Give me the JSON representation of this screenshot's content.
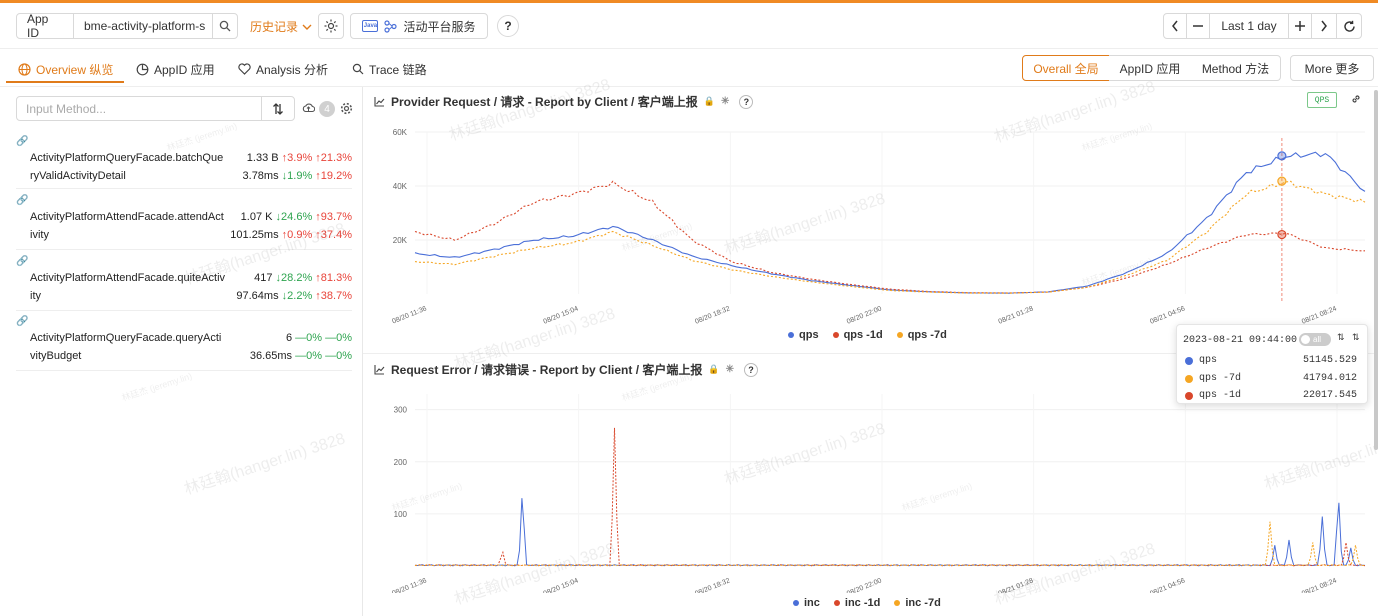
{
  "header": {
    "app_id_label": "App ID",
    "app_id_value": "bme-activity-platform-s",
    "history_label": "历史记录",
    "service_label": "活动平台服务",
    "time_range": "Last 1 day"
  },
  "tabs": [
    {
      "label": "Overview 纵览",
      "active": true
    },
    {
      "label": "AppID 应用",
      "active": false
    },
    {
      "label": "Analysis 分析",
      "active": false
    },
    {
      "label": "Trace 链路",
      "active": false
    }
  ],
  "scope": [
    "Overall 全局",
    "AppID 应用",
    "Method 方法",
    "More 更多"
  ],
  "sidebar": {
    "search_placeholder": "Input Method...",
    "badge": "4",
    "methods": [
      {
        "name": "ActivityPlatformQueryFacade.batchQueryValidActivityDetail",
        "count": "1.33 B",
        "c1": "↑3.9%",
        "c7": "↑21.3%",
        "latency": "3.78ms",
        "l1": "↓1.9%",
        "l7": "↑19.2%"
      },
      {
        "name": "ActivityPlatformAttendFacade.attendActivity",
        "count": "1.07 K",
        "c1": "↓24.6%",
        "c7": "↑93.7%",
        "latency": "101.25ms",
        "l1": "↑0.9%",
        "l7": "↑37.4%"
      },
      {
        "name": "ActivityPlatformAttendFacade.quiteActivity",
        "count": "417",
        "c1": "↓28.2%",
        "c7": "↑81.3%",
        "latency": "97.64ms",
        "l1": "↓2.2%",
        "l7": "↑38.7%"
      },
      {
        "name": "ActivityPlatformQueryFacade.queryActivityBudget",
        "count": "6",
        "c1": "—0%",
        "c7": "—0%",
        "latency": "36.65ms",
        "l1": "—0%",
        "l7": "—0%"
      }
    ]
  },
  "panels": {
    "top": {
      "title": "Provider Request / 请求 - Report by Client / 客户端上报",
      "badge": "QPS"
    },
    "bottom": {
      "title": "Request Error / 请求错误 - Report by Client / 客户端上报"
    }
  },
  "tooltip": {
    "time": "2023-08-21 09:44:00",
    "toggle": "all",
    "rows": [
      {
        "name": "qps",
        "value": "51145.529",
        "color": "#4a6fd8"
      },
      {
        "name": "qps -7d",
        "value": "41794.012",
        "color": "#f5a623"
      },
      {
        "name": "qps -1d",
        "value": "22017.545",
        "color": "#d9472b"
      }
    ]
  },
  "watermark": {
    "text": "林廷翰(hanger.lin) 3828",
    "small": "林廷杰 (jeremy.lin)"
  },
  "chart_data": [
    {
      "type": "line",
      "title": "Provider Request / 请求 - Report by Client / 客户端上报",
      "x_ticks": [
        "08/20 11:36",
        "08/20 15:04",
        "08/20 18:32",
        "08/20 22:00",
        "08/21 01:28",
        "08/21 04:56",
        "08/21 08:24"
      ],
      "y_ticks": [
        "60K",
        "40K",
        "20K"
      ],
      "ylim": [
        0,
        60000
      ],
      "x": [
        0,
        1,
        2,
        3,
        4,
        5,
        6,
        7,
        8,
        9,
        10,
        11,
        12,
        13,
        14,
        15,
        16,
        17,
        18,
        19,
        20,
        21,
        22,
        23,
        24
      ],
      "series": [
        {
          "name": "qps",
          "color": "#4a6fd8",
          "dash": false,
          "values": [
            15000,
            13500,
            16500,
            20000,
            21500,
            25000,
            20000,
            14000,
            10500,
            7500,
            5000,
            3200,
            1500,
            800,
            400,
            300,
            800,
            3000,
            8000,
            15000,
            28000,
            45000,
            51000,
            52000,
            38000
          ]
        },
        {
          "name": "qps -1d",
          "color": "#d9472b",
          "dash": true,
          "values": [
            23000,
            20000,
            26000,
            34000,
            37000,
            41000,
            34000,
            20000,
            12000,
            8000,
            5500,
            3500,
            1800,
            900,
            500,
            400,
            700,
            2500,
            6000,
            11000,
            17000,
            22000,
            22500,
            17000,
            16000
          ]
        },
        {
          "name": "qps -7d",
          "color": "#f5a623",
          "dash": true,
          "values": [
            12000,
            11000,
            14000,
            17000,
            19000,
            23000,
            18000,
            12500,
            9000,
            6500,
            4500,
            2800,
            1300,
            700,
            350,
            300,
            700,
            2500,
            7000,
            12500,
            23000,
            37000,
            41500,
            37000,
            34000
          ]
        }
      ]
    },
    {
      "type": "line",
      "title": "Request Error / 请求错误 - Report by Client / 客户端上报",
      "x_ticks": [
        "08/20 11:36",
        "08/20 15:04",
        "08/20 18:32",
        "08/20 22:00",
        "08/21 01:28",
        "08/21 04:56",
        "08/21 08:24"
      ],
      "y_ticks": [
        "300",
        "200",
        "100"
      ],
      "ylim": [
        0,
        330
      ],
      "series": [
        {
          "name": "inc",
          "color": "#4a6fd8",
          "dash": false,
          "spikes": [
            [
              0.113,
              150
            ],
            [
              0.905,
              40
            ],
            [
              0.92,
              50
            ],
            [
              0.955,
              95
            ],
            [
              0.972,
              140
            ],
            [
              0.985,
              35
            ]
          ]
        },
        {
          "name": "inc -1d",
          "color": "#d9472b",
          "dash": true,
          "spikes": [
            [
              0.21,
              265
            ],
            [
              0.092,
              30
            ],
            [
              0.98,
              45
            ]
          ]
        },
        {
          "name": "inc -7d",
          "color": "#f5a623",
          "dash": true,
          "spikes": [
            [
              0.9,
              85
            ],
            [
              0.945,
              45
            ],
            [
              0.99,
              40
            ]
          ]
        }
      ]
    }
  ]
}
